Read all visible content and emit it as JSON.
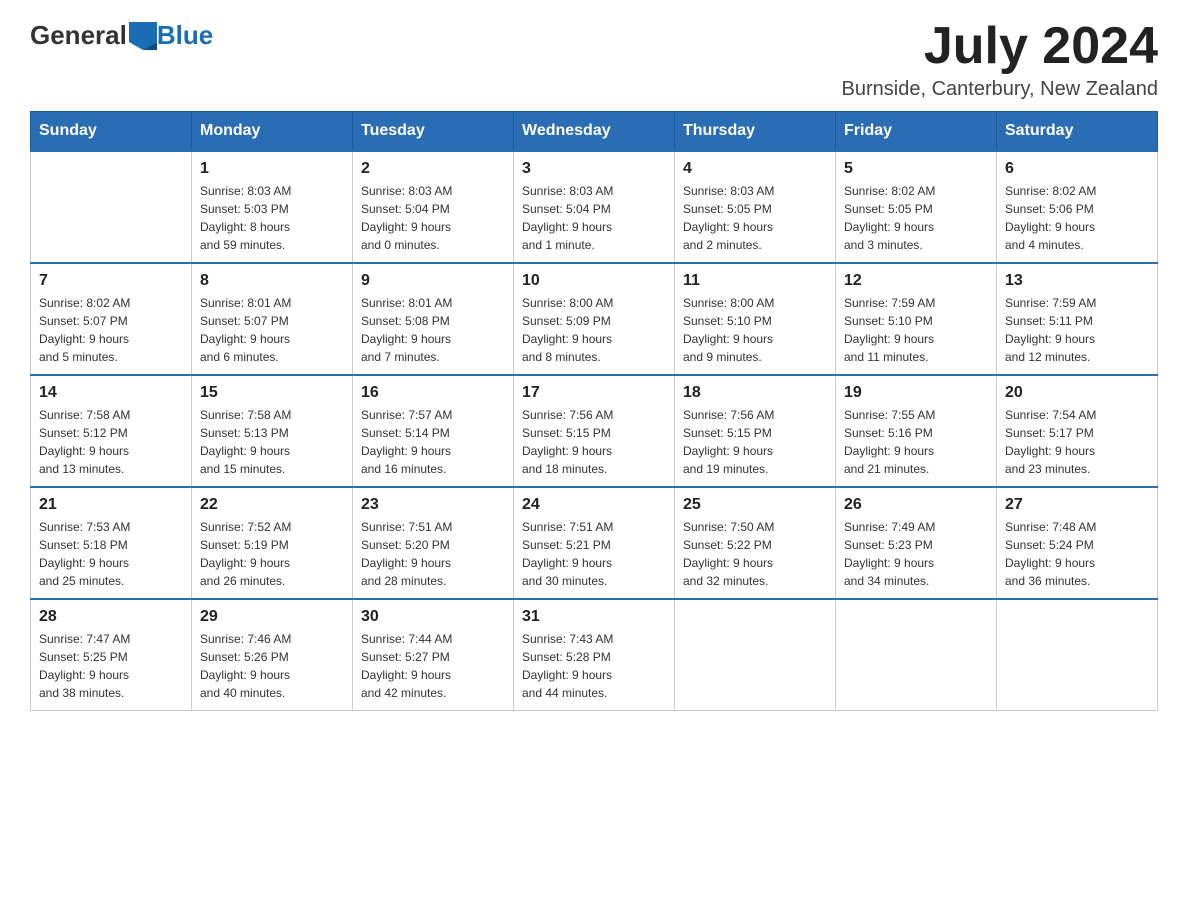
{
  "header": {
    "logo": {
      "general": "General",
      "blue": "Blue"
    },
    "title": "July 2024",
    "location": "Burnside, Canterbury, New Zealand"
  },
  "days_of_week": [
    "Sunday",
    "Monday",
    "Tuesday",
    "Wednesday",
    "Thursday",
    "Friday",
    "Saturday"
  ],
  "weeks": [
    [
      {
        "day": "",
        "info": ""
      },
      {
        "day": "1",
        "info": "Sunrise: 8:03 AM\nSunset: 5:03 PM\nDaylight: 8 hours\nand 59 minutes."
      },
      {
        "day": "2",
        "info": "Sunrise: 8:03 AM\nSunset: 5:04 PM\nDaylight: 9 hours\nand 0 minutes."
      },
      {
        "day": "3",
        "info": "Sunrise: 8:03 AM\nSunset: 5:04 PM\nDaylight: 9 hours\nand 1 minute."
      },
      {
        "day": "4",
        "info": "Sunrise: 8:03 AM\nSunset: 5:05 PM\nDaylight: 9 hours\nand 2 minutes."
      },
      {
        "day": "5",
        "info": "Sunrise: 8:02 AM\nSunset: 5:05 PM\nDaylight: 9 hours\nand 3 minutes."
      },
      {
        "day": "6",
        "info": "Sunrise: 8:02 AM\nSunset: 5:06 PM\nDaylight: 9 hours\nand 4 minutes."
      }
    ],
    [
      {
        "day": "7",
        "info": "Sunrise: 8:02 AM\nSunset: 5:07 PM\nDaylight: 9 hours\nand 5 minutes."
      },
      {
        "day": "8",
        "info": "Sunrise: 8:01 AM\nSunset: 5:07 PM\nDaylight: 9 hours\nand 6 minutes."
      },
      {
        "day": "9",
        "info": "Sunrise: 8:01 AM\nSunset: 5:08 PM\nDaylight: 9 hours\nand 7 minutes."
      },
      {
        "day": "10",
        "info": "Sunrise: 8:00 AM\nSunset: 5:09 PM\nDaylight: 9 hours\nand 8 minutes."
      },
      {
        "day": "11",
        "info": "Sunrise: 8:00 AM\nSunset: 5:10 PM\nDaylight: 9 hours\nand 9 minutes."
      },
      {
        "day": "12",
        "info": "Sunrise: 7:59 AM\nSunset: 5:10 PM\nDaylight: 9 hours\nand 11 minutes."
      },
      {
        "day": "13",
        "info": "Sunrise: 7:59 AM\nSunset: 5:11 PM\nDaylight: 9 hours\nand 12 minutes."
      }
    ],
    [
      {
        "day": "14",
        "info": "Sunrise: 7:58 AM\nSunset: 5:12 PM\nDaylight: 9 hours\nand 13 minutes."
      },
      {
        "day": "15",
        "info": "Sunrise: 7:58 AM\nSunset: 5:13 PM\nDaylight: 9 hours\nand 15 minutes."
      },
      {
        "day": "16",
        "info": "Sunrise: 7:57 AM\nSunset: 5:14 PM\nDaylight: 9 hours\nand 16 minutes."
      },
      {
        "day": "17",
        "info": "Sunrise: 7:56 AM\nSunset: 5:15 PM\nDaylight: 9 hours\nand 18 minutes."
      },
      {
        "day": "18",
        "info": "Sunrise: 7:56 AM\nSunset: 5:15 PM\nDaylight: 9 hours\nand 19 minutes."
      },
      {
        "day": "19",
        "info": "Sunrise: 7:55 AM\nSunset: 5:16 PM\nDaylight: 9 hours\nand 21 minutes."
      },
      {
        "day": "20",
        "info": "Sunrise: 7:54 AM\nSunset: 5:17 PM\nDaylight: 9 hours\nand 23 minutes."
      }
    ],
    [
      {
        "day": "21",
        "info": "Sunrise: 7:53 AM\nSunset: 5:18 PM\nDaylight: 9 hours\nand 25 minutes."
      },
      {
        "day": "22",
        "info": "Sunrise: 7:52 AM\nSunset: 5:19 PM\nDaylight: 9 hours\nand 26 minutes."
      },
      {
        "day": "23",
        "info": "Sunrise: 7:51 AM\nSunset: 5:20 PM\nDaylight: 9 hours\nand 28 minutes."
      },
      {
        "day": "24",
        "info": "Sunrise: 7:51 AM\nSunset: 5:21 PM\nDaylight: 9 hours\nand 30 minutes."
      },
      {
        "day": "25",
        "info": "Sunrise: 7:50 AM\nSunset: 5:22 PM\nDaylight: 9 hours\nand 32 minutes."
      },
      {
        "day": "26",
        "info": "Sunrise: 7:49 AM\nSunset: 5:23 PM\nDaylight: 9 hours\nand 34 minutes."
      },
      {
        "day": "27",
        "info": "Sunrise: 7:48 AM\nSunset: 5:24 PM\nDaylight: 9 hours\nand 36 minutes."
      }
    ],
    [
      {
        "day": "28",
        "info": "Sunrise: 7:47 AM\nSunset: 5:25 PM\nDaylight: 9 hours\nand 38 minutes."
      },
      {
        "day": "29",
        "info": "Sunrise: 7:46 AM\nSunset: 5:26 PM\nDaylight: 9 hours\nand 40 minutes."
      },
      {
        "day": "30",
        "info": "Sunrise: 7:44 AM\nSunset: 5:27 PM\nDaylight: 9 hours\nand 42 minutes."
      },
      {
        "day": "31",
        "info": "Sunrise: 7:43 AM\nSunset: 5:28 PM\nDaylight: 9 hours\nand 44 minutes."
      },
      {
        "day": "",
        "info": ""
      },
      {
        "day": "",
        "info": ""
      },
      {
        "day": "",
        "info": ""
      }
    ]
  ]
}
